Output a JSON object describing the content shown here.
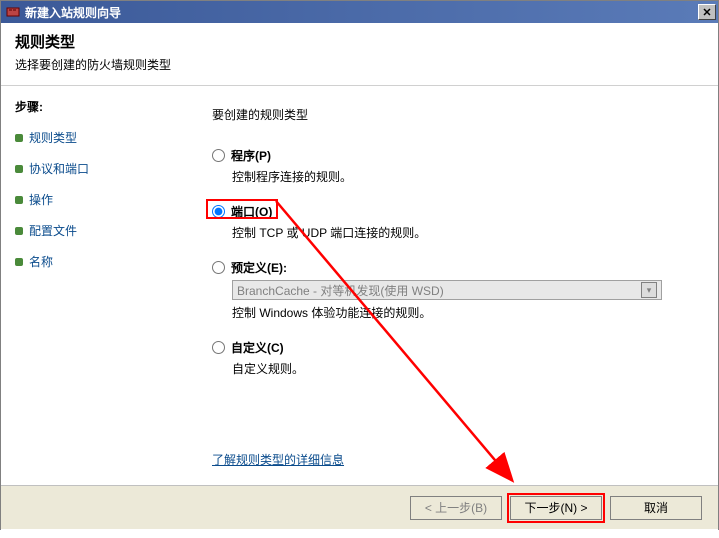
{
  "window": {
    "title": "新建入站规则向导"
  },
  "header": {
    "title": "规则类型",
    "subtitle": "选择要创建的防火墙规则类型"
  },
  "sidebar": {
    "steps_label": "步骤:",
    "items": [
      {
        "label": "规则类型"
      },
      {
        "label": "协议和端口"
      },
      {
        "label": "操作"
      },
      {
        "label": "配置文件"
      },
      {
        "label": "名称"
      }
    ]
  },
  "main": {
    "prompt": "要创建的规则类型",
    "options": {
      "program": {
        "label": "程序(P)",
        "desc": "控制程序连接的规则。"
      },
      "port": {
        "label": "端口(O)",
        "desc": "控制 TCP 或 UDP 端口连接的规则。"
      },
      "predefined": {
        "label": "预定义(E):",
        "desc": "控制 Windows 体验功能连接的规则。",
        "select_value": "BranchCache - 对等机发现(使用 WSD)"
      },
      "custom": {
        "label": "自定义(C)",
        "desc": "自定义规则。"
      }
    },
    "learn_more": "了解规则类型的详细信息"
  },
  "footer": {
    "back": "< 上一步(B)",
    "next": "下一步(N) >",
    "cancel": "取消"
  }
}
